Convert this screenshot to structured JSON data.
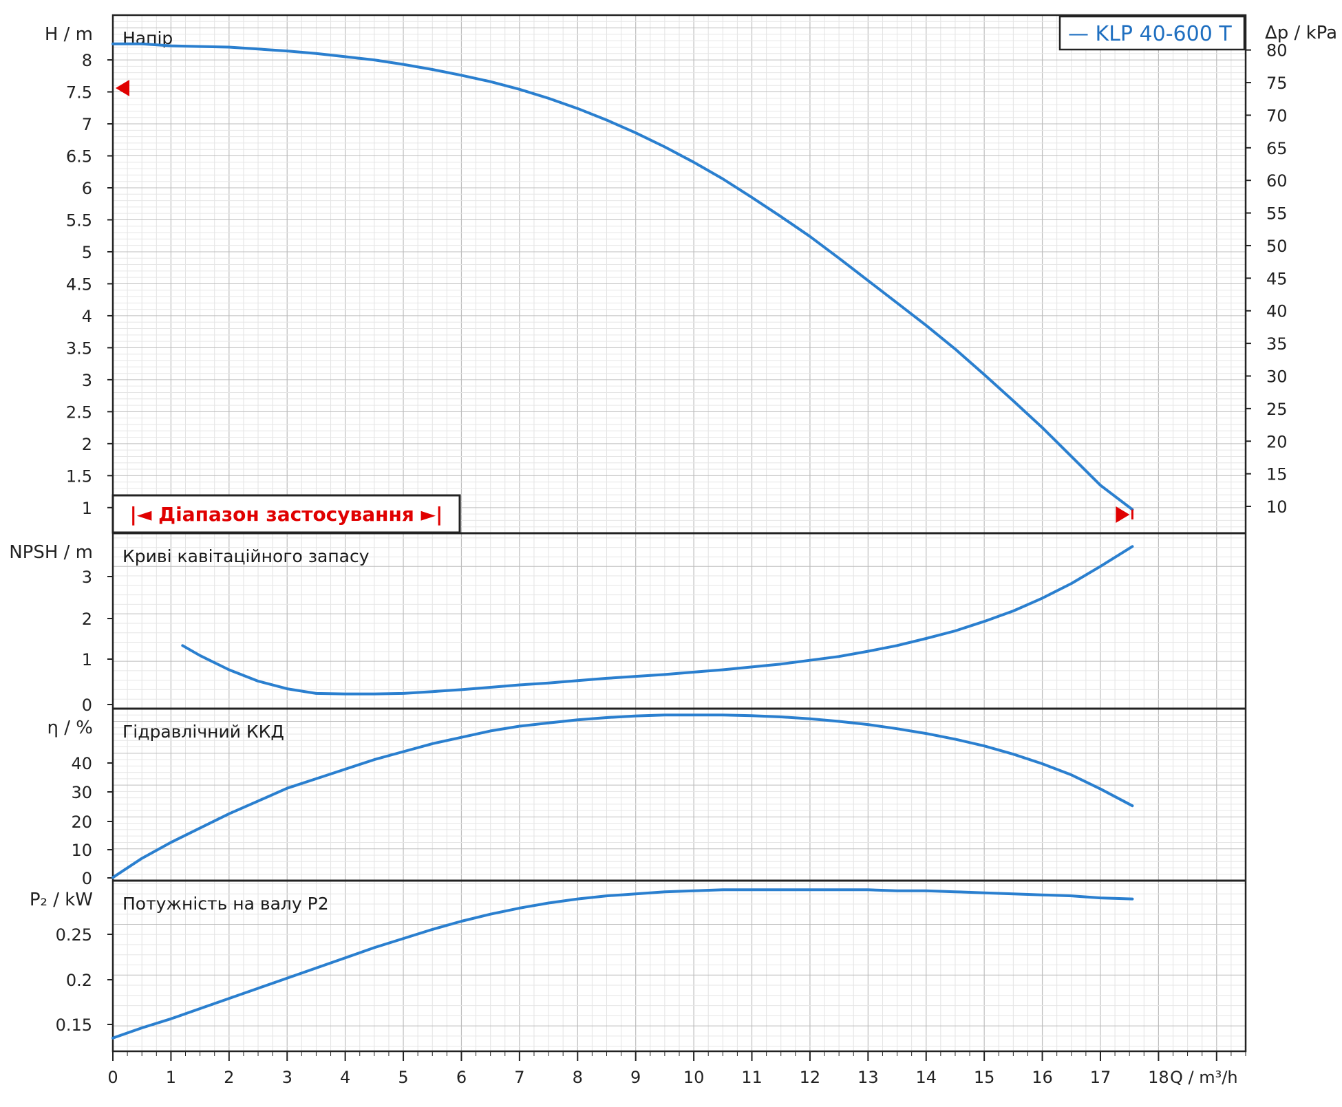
{
  "chart_data": [
    {
      "type": "line",
      "title": "Напір",
      "ylabel": "H / m",
      "ylabel_right": "Δp / kPa",
      "ylim": [
        0.6,
        8.7
      ],
      "yticks": [
        "1",
        "1.5",
        "2",
        "2.5",
        "3",
        "3.5",
        "4",
        "4.5",
        "5",
        "5.5",
        "6",
        "6.5",
        "7",
        "7.5",
        "8"
      ],
      "yticks_right": [
        "10",
        "15",
        "20",
        "25",
        "30",
        "35",
        "40",
        "45",
        "50",
        "55",
        "60",
        "65",
        "70",
        "75",
        "80"
      ],
      "legend": {
        "label": "— KLP 40-600 T",
        "position": "top-right"
      },
      "range_label": "|◄ Діапазон застосування ►|",
      "series": [
        {
          "name": "KLP 40-600 T",
          "color": "#2a7fcf",
          "x": [
            0,
            0.5,
            1,
            1.5,
            2,
            2.5,
            3,
            3.5,
            4,
            4.5,
            5,
            5.5,
            6,
            6.5,
            7,
            7.5,
            8,
            8.5,
            9,
            9.5,
            10,
            10.5,
            11,
            11.5,
            12,
            12.5,
            13,
            13.5,
            14,
            14.5,
            15,
            15.5,
            16,
            16.5,
            17,
            17.55
          ],
          "y": [
            8.25,
            8.25,
            8.22,
            8.21,
            8.2,
            8.17,
            8.14,
            8.1,
            8.05,
            8.0,
            7.93,
            7.85,
            7.76,
            7.66,
            7.54,
            7.4,
            7.24,
            7.06,
            6.86,
            6.64,
            6.4,
            6.14,
            5.85,
            5.55,
            5.24,
            4.9,
            4.55,
            4.2,
            3.85,
            3.48,
            3.08,
            2.67,
            2.25,
            1.8,
            1.35,
            0.97
          ]
        }
      ]
    },
    {
      "type": "line",
      "title": "Криві кавітаційного запасу",
      "ylabel": "NPSH / m",
      "ylim": [
        0,
        3.7
      ],
      "yticks": [
        "0",
        "1",
        "2",
        "3"
      ],
      "series": [
        {
          "color": "#2a7fcf",
          "x": [
            1.2,
            1.5,
            2,
            2.5,
            3,
            3.5,
            4,
            4.5,
            5,
            5.5,
            6,
            6.5,
            7,
            7.5,
            8,
            8.5,
            9,
            9.5,
            10,
            10.5,
            11,
            11.5,
            12,
            12.5,
            13,
            13.5,
            14,
            14.5,
            15,
            15.5,
            16,
            16.5,
            17,
            17.55
          ],
          "y": [
            1.33,
            1.12,
            0.82,
            0.58,
            0.42,
            0.32,
            0.31,
            0.31,
            0.32,
            0.36,
            0.4,
            0.45,
            0.5,
            0.54,
            0.59,
            0.64,
            0.68,
            0.72,
            0.77,
            0.82,
            0.88,
            0.94,
            1.02,
            1.1,
            1.21,
            1.33,
            1.48,
            1.64,
            1.84,
            2.06,
            2.33,
            2.64,
            3.0,
            3.42
          ]
        }
      ]
    },
    {
      "type": "line",
      "title": "Гідравлічний ККД",
      "ylabel": "η / %",
      "ylim": [
        0,
        54
      ],
      "yticks": [
        "0",
        "10",
        "20",
        "30",
        "40"
      ],
      "series": [
        {
          "color": "#2a7fcf",
          "x": [
            0,
            0.5,
            1,
            1.5,
            2,
            2.5,
            3,
            3.5,
            4,
            4.5,
            5,
            5.5,
            6,
            6.5,
            7,
            7.5,
            8,
            8.5,
            9,
            9.5,
            10,
            10.5,
            11,
            11.5,
            12,
            12.5,
            13,
            13.5,
            14,
            14.5,
            15,
            15.5,
            16,
            16.5,
            17,
            17.55
          ],
          "y": [
            1,
            7,
            12,
            16.5,
            21,
            25,
            29,
            32,
            35,
            38,
            40.5,
            43,
            45,
            47,
            48.5,
            49.5,
            50.5,
            51.2,
            51.7,
            52,
            52,
            52,
            51.8,
            51.4,
            50.8,
            50,
            49,
            47.7,
            46.2,
            44.4,
            42.3,
            39.7,
            36.7,
            33.2,
            28.8,
            23.5
          ]
        }
      ]
    },
    {
      "type": "line",
      "title": "Потужність на валу P2",
      "ylabel": "P₂ / kW",
      "xlabel": "Q / m³/h",
      "ylim": [
        0.125,
        0.293
      ],
      "yticks": [
        "0.15",
        "0.2",
        "0.25"
      ],
      "xlim": [
        0,
        19.5
      ],
      "xticks": [
        "0",
        "1",
        "2",
        "3",
        "4",
        "5",
        "6",
        "7",
        "8",
        "9",
        "10",
        "11",
        "12",
        "13",
        "14",
        "15",
        "16",
        "17",
        "18"
      ],
      "series": [
        {
          "color": "#2a7fcf",
          "x": [
            0,
            0.5,
            1,
            1.5,
            2,
            2.5,
            3,
            3.5,
            4,
            4.5,
            5,
            5.5,
            6,
            6.5,
            7,
            7.5,
            8,
            8.5,
            9,
            9.5,
            10,
            10.5,
            11,
            11.5,
            12,
            12.5,
            13,
            13.5,
            14,
            14.5,
            15,
            15.5,
            16,
            16.5,
            17,
            17.55
          ],
          "y": [
            0.138,
            0.148,
            0.157,
            0.167,
            0.177,
            0.187,
            0.197,
            0.207,
            0.217,
            0.227,
            0.236,
            0.245,
            0.253,
            0.26,
            0.266,
            0.271,
            0.275,
            0.278,
            0.28,
            0.282,
            0.283,
            0.284,
            0.284,
            0.284,
            0.284,
            0.284,
            0.284,
            0.283,
            0.283,
            0.282,
            0.281,
            0.28,
            0.279,
            0.278,
            0.276,
            0.275
          ]
        }
      ]
    }
  ]
}
